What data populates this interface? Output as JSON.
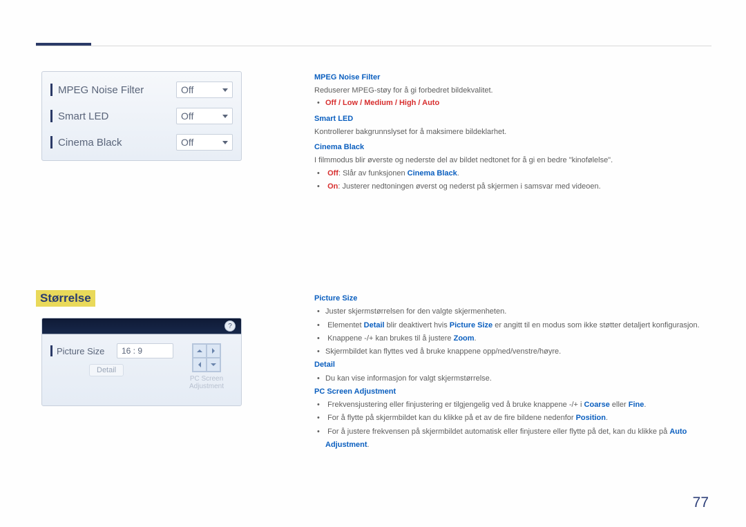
{
  "page_number": "77",
  "osd1": {
    "rows": [
      {
        "label": "MPEG Noise Filter",
        "value": "Off"
      },
      {
        "label": "Smart LED",
        "value": "Off"
      },
      {
        "label": "Cinema Black",
        "value": "Off"
      }
    ]
  },
  "section1": {
    "mpeg_title": "MPEG Noise Filter",
    "mpeg_desc": "Reduserer MPEG-støy for å gi forbedret bildekvalitet.",
    "mpeg_options": "Off / Low / Medium / High / Auto",
    "smartled_title": "Smart LED",
    "smartled_desc": "Kontrollerer bakgrunnslyset for å maksimere bildeklarhet.",
    "cinema_title": "Cinema Black",
    "cinema_desc": "I filmmodus blir øverste og nederste del av bildet nedtonet for å gi en bedre \"kinofølelse\".",
    "cinema_off_pre": "Off",
    "cinema_off_mid": ": Slår av funksjonen ",
    "cinema_off_link": "Cinema Black",
    "cinema_off_post": ".",
    "cinema_on_pre": "On",
    "cinema_on_post": ": Justerer nedtoningen øverst og nederst på skjermen i samsvar med videoen."
  },
  "section2_title": "Størrelse",
  "osd2": {
    "help": "?",
    "ps_label": "Picture Size",
    "ps_value": "16 : 9",
    "detail_btn": "Detail",
    "pcsa_label": "PC Screen Adjustment"
  },
  "section2": {
    "ps_title": "Picture Size",
    "ps_b1": "Juster skjermstørrelsen for den valgte skjermenheten.",
    "ps_b2_a": "Elementet ",
    "ps_b2_detail": "Detail",
    "ps_b2_b": " blir deaktivert hvis ",
    "ps_b2_ps": "Picture Size",
    "ps_b2_c": " er angitt til en modus som ikke støtter detaljert konfigurasjon.",
    "ps_b3_a": "Knappene -/+ kan brukes til å justere ",
    "ps_b3_zoom": "Zoom",
    "ps_b3_b": ".",
    "ps_b4": "Skjermbildet kan flyttes ved å bruke knappene opp/ned/venstre/høyre.",
    "detail_title": "Detail",
    "detail_b1": "Du kan vise informasjon for valgt skjermstørrelse.",
    "pcsa_title": "PC Screen Adjustment",
    "pcsa_b1_a": "Frekvensjustering eller finjustering er tilgjengelig ved å bruke knappene -/+ i ",
    "pcsa_b1_coarse": "Coarse",
    "pcsa_b1_or": " eller ",
    "pcsa_b1_fine": "Fine",
    "pcsa_b1_b": ".",
    "pcsa_b2_a": "For å flytte på skjermbildet kan du klikke på et av de fire bildene nedenfor ",
    "pcsa_b2_position": "Position",
    "pcsa_b2_b": ".",
    "pcsa_b3_a": "For å justere frekvensen på skjermbildet automatisk eller finjustere eller flytte på det, kan du klikke på ",
    "pcsa_b3_auto": "Auto Adjustment",
    "pcsa_b3_b": "."
  }
}
